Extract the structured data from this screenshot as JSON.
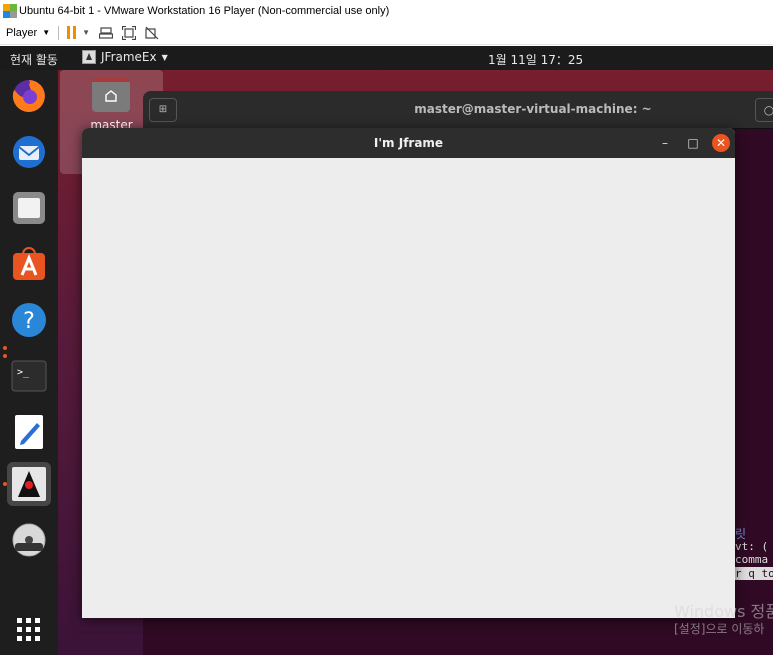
{
  "vmware": {
    "window_title": "Ubuntu 64-bit 1 - VMware Workstation 16 Player (Non-commercial use only)",
    "player_label": "Player"
  },
  "ubuntu": {
    "activities": "현재 활동",
    "app_menu": "JFrameEx",
    "clock": "1월 11일  17：25",
    "desktop_icon_label": "master"
  },
  "dock": {
    "items": [
      "firefox",
      "thunderbird",
      "files",
      "software",
      "help",
      "terminal",
      "text-editor",
      "java",
      "dvd"
    ]
  },
  "terminal": {
    "title": "master@master-virtual-machine: ~",
    "lines": [
      "vt: (",
      "comma",
      "r q to"
    ],
    "korean_fragment": "릿"
  },
  "jframe": {
    "title": "I'm Jframe",
    "minimize": "–",
    "maximize": "□",
    "close": "✕"
  },
  "watermark": {
    "line1": "Windows 정품",
    "line2": "[설정]으로 이동하"
  }
}
